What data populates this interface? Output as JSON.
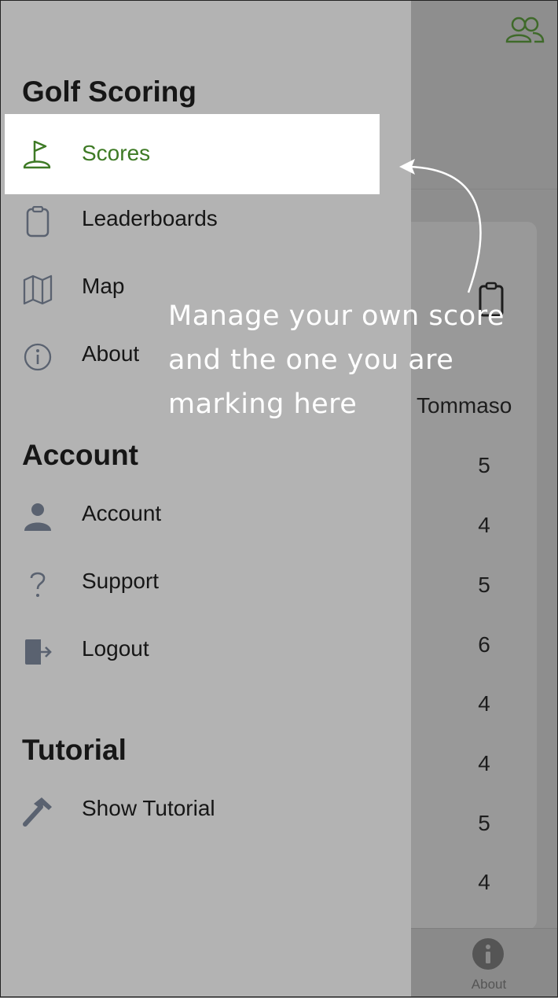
{
  "drawer": {
    "sections": [
      {
        "title": "Golf Scoring"
      },
      {
        "title": "Account"
      },
      {
        "title": "Tutorial"
      }
    ],
    "golf_items": [
      {
        "label": "Scores",
        "icon": "flag-icon",
        "selected": true
      },
      {
        "label": "Leaderboards",
        "icon": "clipboard-icon"
      },
      {
        "label": "Map",
        "icon": "map-icon"
      },
      {
        "label": "About",
        "icon": "info-icon"
      }
    ],
    "account_items": [
      {
        "label": "Account",
        "icon": "person-icon"
      },
      {
        "label": "Support",
        "icon": "question-icon"
      },
      {
        "label": "Logout",
        "icon": "logout-icon"
      }
    ],
    "tutorial_items": [
      {
        "label": "Show Tutorial",
        "icon": "hammer-icon"
      }
    ]
  },
  "tutorial_tip": {
    "line1": "Manage your own score",
    "line2": "and the one you are",
    "line3": "marking here"
  },
  "scorecard": {
    "player": "Tommaso",
    "scores": [
      "5",
      "4",
      "5",
      "6",
      "4",
      "4",
      "5",
      "4"
    ]
  },
  "tabbar": {
    "about_label": "About"
  },
  "colors": {
    "accent": "#3e7a25",
    "drawer_bg": "#b3b3b3",
    "icon": "#5a6270"
  }
}
